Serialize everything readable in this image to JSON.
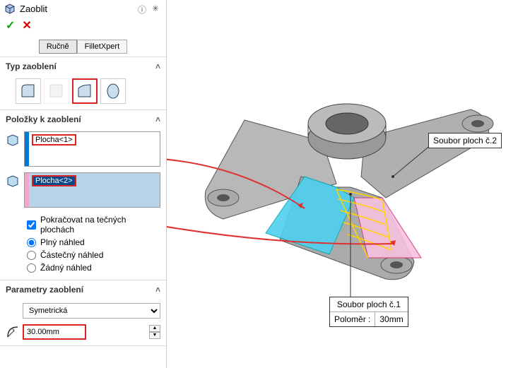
{
  "header": {
    "title": "Zaoblit"
  },
  "tabs": {
    "manual": "Ručně",
    "xpert": "FilletXpert"
  },
  "sections": {
    "type": {
      "title": "Typ zaoblení"
    },
    "items": {
      "title": "Položky k zaoblení",
      "face1": "Plocha<1>",
      "face2": "Plocha<2>",
      "tangent": "Pokračovat na tečných plochách",
      "full": "Plný náhled",
      "partial": "Částečný náhled",
      "none": "Žádný náhled"
    },
    "params": {
      "title": "Parametry zaoblení",
      "symmetry": "Symetrická",
      "radius": "30.00mm"
    }
  },
  "callouts": {
    "set1": {
      "title": "Soubor ploch č.1",
      "radius_label": "Poloměr  :",
      "radius_value": "30mm"
    },
    "set2": {
      "title": "Soubor ploch č.2"
    }
  }
}
